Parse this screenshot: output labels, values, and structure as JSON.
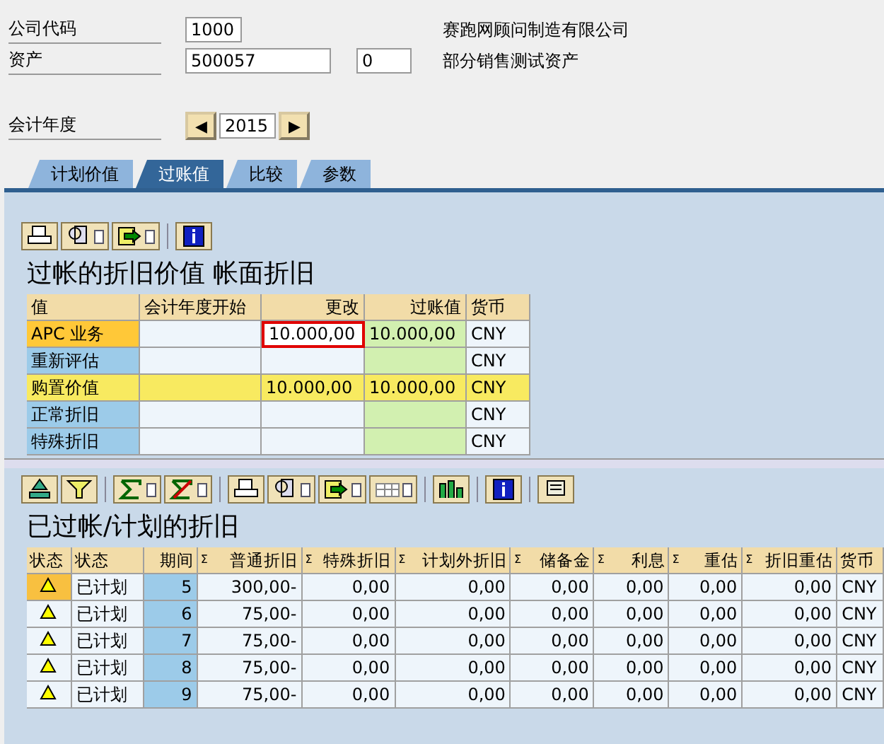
{
  "header": {
    "fields": [
      {
        "label": "公司代码",
        "value": "1000",
        "description": "赛跑网顾问制造有限公司"
      },
      {
        "label": "资产",
        "value": "500057",
        "sub_value": "0",
        "description": "部分销售测试资产"
      }
    ],
    "fiscal_year": {
      "label": "会计年度",
      "value": "2015",
      "prev": "◀",
      "next": "▶"
    }
  },
  "tabs": [
    {
      "label": "计划价值",
      "selected": false
    },
    {
      "label": "过账值",
      "selected": true
    },
    {
      "label": "比较",
      "selected": false
    },
    {
      "label": "参数",
      "selected": false
    }
  ],
  "values_section": {
    "title": "过帐的折旧价值 帐面折旧",
    "columns": [
      "值",
      "会计年度开始",
      "更改",
      "过账值",
      "货币"
    ],
    "rows": [
      {
        "kind": "current",
        "label": "APC 业务",
        "start": "",
        "change": "10.000,00",
        "posted": "10.000,00",
        "currency": "CNY",
        "focused": true
      },
      {
        "kind": "normal",
        "label": "重新评估",
        "start": "",
        "change": "",
        "posted": "",
        "currency": "CNY",
        "focused": false
      },
      {
        "kind": "total",
        "label": "购置价值",
        "start": "",
        "change": "10.000,00",
        "posted": "10.000,00",
        "currency": "CNY",
        "focused": false
      },
      {
        "kind": "normal",
        "label": "正常折旧",
        "start": "",
        "change": "",
        "posted": "",
        "currency": "CNY",
        "focused": false
      },
      {
        "kind": "normal",
        "label": "特殊折旧",
        "start": "",
        "change": "",
        "posted": "",
        "currency": "CNY",
        "focused": false
      }
    ]
  },
  "depreciation_section": {
    "title": "已过帐/计划的折旧",
    "columns": [
      {
        "label": "状态"
      },
      {
        "label": "状态"
      },
      {
        "label": "期间"
      },
      {
        "label": "普通折旧",
        "mark": "Σ"
      },
      {
        "label": "特殊折旧",
        "mark": "Σ"
      },
      {
        "label": "计划外折旧",
        "mark": "Σ"
      },
      {
        "label": "储备金",
        "mark": "Σ"
      },
      {
        "label": "利息",
        "mark": "Σ"
      },
      {
        "label": "重估",
        "mark": "Σ"
      },
      {
        "label": "折旧重估",
        "mark": "Σ"
      },
      {
        "label": "货币"
      }
    ],
    "rows": [
      {
        "selected": true,
        "status": "已计划",
        "period": "5",
        "values": [
          "300,00-",
          "0,00",
          "0,00",
          "0,00",
          "0,00",
          "0,00",
          "0,00"
        ],
        "currency": "CNY"
      },
      {
        "selected": false,
        "status": "已计划",
        "period": "6",
        "values": [
          "75,00-",
          "0,00",
          "0,00",
          "0,00",
          "0,00",
          "0,00",
          "0,00"
        ],
        "currency": "CNY"
      },
      {
        "selected": false,
        "status": "已计划",
        "period": "7",
        "values": [
          "75,00-",
          "0,00",
          "0,00",
          "0,00",
          "0,00",
          "0,00",
          "0,00"
        ],
        "currency": "CNY"
      },
      {
        "selected": false,
        "status": "已计划",
        "period": "8",
        "values": [
          "75,00-",
          "0,00",
          "0,00",
          "0,00",
          "0,00",
          "0,00",
          "0,00"
        ],
        "currency": "CNY"
      },
      {
        "selected": false,
        "status": "已计划",
        "period": "9",
        "values": [
          "75,00-",
          "0,00",
          "0,00",
          "0,00",
          "0,00",
          "0,00",
          "0,00"
        ],
        "currency": "CNY"
      }
    ]
  }
}
